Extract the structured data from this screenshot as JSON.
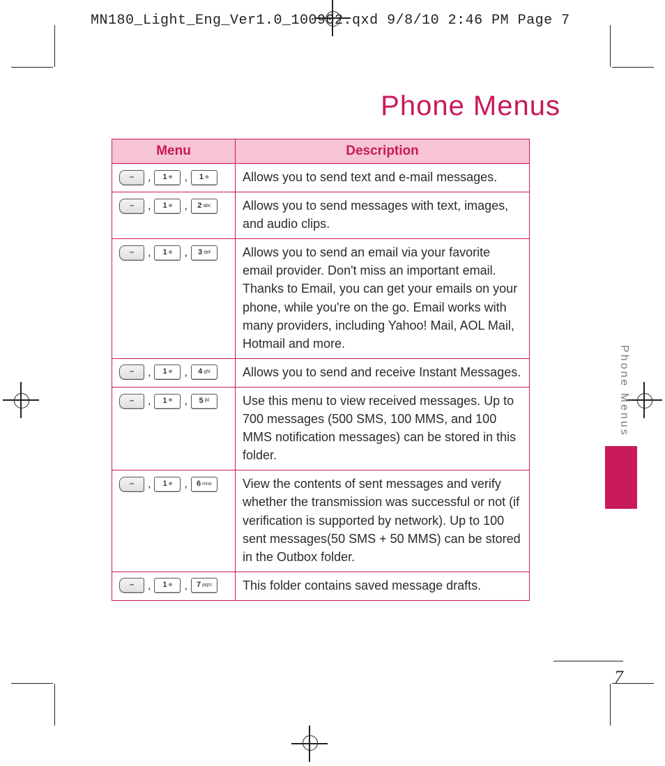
{
  "print_header": "MN180_Light_Eng_Ver1.0_100902.qxd  9/8/10  2:46 PM  Page 7",
  "title": "Phone Menus",
  "side_label": "Phone Menus",
  "page_number": "7",
  "table": {
    "headers": {
      "menu": "Menu",
      "description": "Description"
    },
    "rows": [
      {
        "keys": [
          "soft",
          "1",
          "1"
        ],
        "desc": "Allows you to send text and e-mail messages."
      },
      {
        "keys": [
          "soft",
          "1",
          "2"
        ],
        "desc": "Allows you to send messages with text, images, and audio clips."
      },
      {
        "keys": [
          "soft",
          "1",
          "3"
        ],
        "desc": "Allows you to send an email via your favorite email provider. Don't miss an important email. Thanks to Email, you can get your emails on your phone, while you're on the go. Email works with many providers, including Yahoo! Mail, AOL Mail, Hotmail and more."
      },
      {
        "keys": [
          "soft",
          "1",
          "4"
        ],
        "desc": "Allows you to send and receive Instant Messages."
      },
      {
        "keys": [
          "soft",
          "1",
          "5"
        ],
        "desc": "Use this menu to view received messages. Up to 700 messages (500 SMS, 100 MMS, and 100 MMS notification messages) can be stored in this folder."
      },
      {
        "keys": [
          "soft",
          "1",
          "6"
        ],
        "desc": "View the contents of sent messages and verify whether the transmission was successful or not (if verification is supported by network). Up to 100 sent messages(50 SMS + 50 MMS) can be stored in the Outbox folder."
      },
      {
        "keys": [
          "soft",
          "1",
          "7"
        ],
        "desc": "This folder contains saved message drafts."
      }
    ]
  },
  "key_labels": {
    "soft": "–",
    "1": "1",
    "2": "2",
    "2_sub": "abc",
    "3": "3",
    "3_sub": "def",
    "4": "4",
    "4_sub": "ghi",
    "5": "5",
    "5_sub": "jkl",
    "6": "6",
    "6_sub": "mno",
    "7": "7",
    "7_sub": "pqrs"
  }
}
